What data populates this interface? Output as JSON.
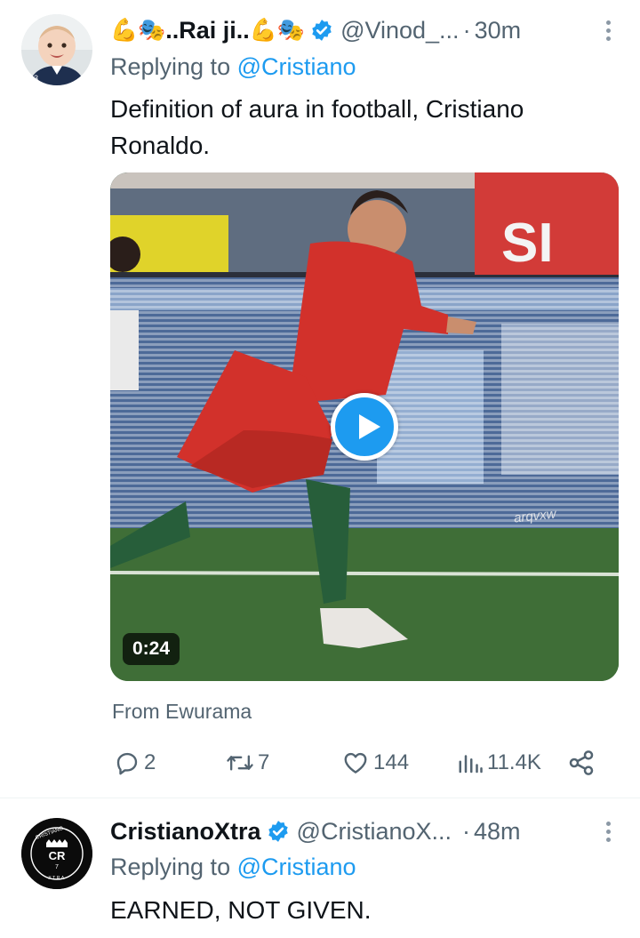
{
  "tweets": [
    {
      "display_name_prefix": "💪🎭",
      "display_name_core": "..Rai ji..",
      "display_name_suffix": "💪🎭",
      "handle": "@Vinod_...",
      "separator": "·",
      "time": "30m",
      "replying_prefix": "Replying to",
      "replying_to": "@Cristiano",
      "text": "Definition of aura in football, Cristiano Ronaldo.",
      "video": {
        "duration": "0:24",
        "watermark": "arqvxw",
        "banner_text": "SI"
      },
      "attribution": "From Ewurama",
      "actions": {
        "replies": "2",
        "retweets": "7",
        "likes": "144",
        "views": "11.4K"
      }
    },
    {
      "display_name": "CristianoXtra",
      "handle": "@CristianoX...",
      "separator": "·",
      "time": "48m",
      "replying_prefix": "Replying to",
      "replying_to": "@Cristiano",
      "text": "EARNED, NOT GIVEN.",
      "avatar_logo": {
        "ring_text": "CRISTIANO",
        "monogram": "CR",
        "number": "7",
        "bottom_text": "XTRA"
      }
    }
  ],
  "colors": {
    "accent": "#1d9bf0",
    "text": "#0f1419",
    "muted": "#536471",
    "divider": "#eff3f4"
  },
  "icons": [
    "reply-icon",
    "retweet-icon",
    "like-icon",
    "views-icon",
    "share-icon",
    "verified-badge-icon",
    "more-icon",
    "play-icon"
  ]
}
